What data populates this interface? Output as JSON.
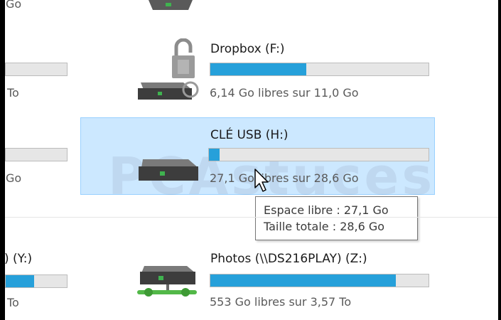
{
  "drives": {
    "top_partial": {
      "size_text": "Go"
    },
    "dropbox": {
      "name": "Dropbox (F:)",
      "space_text": "6,14 Go libres sur 11,0 Go",
      "used_fraction": 0.44,
      "icon": "locked-drive-icon"
    },
    "usb": {
      "name": "CLÉ USB (H:)",
      "space_text": "27,1 Go libres sur 28,6 Go",
      "used_fraction": 0.05,
      "icon": "usb-drive-icon"
    },
    "photos": {
      "name": "Photos (\\\\DS216PLAY) (Z:)",
      "space_text": "553 Go libres sur 3,57 To",
      "used_fraction": 0.85,
      "icon": "network-drive-icon"
    },
    "left_col": {
      "row1_size": "To",
      "row2_size": "Go",
      "row3_name": ") (Y:)",
      "row3_size": "To"
    }
  },
  "tooltip": {
    "free_space": "Espace libre : 27,1 Go",
    "total_size": "Taille totale : 28,6 Go"
  },
  "watermark": "PCAstuces",
  "colors": {
    "bar_fill": "#26a0da",
    "bar_empty": "#e6e6e6",
    "selection_bg": "#cce8ff",
    "selection_border": "#99d1ff"
  }
}
